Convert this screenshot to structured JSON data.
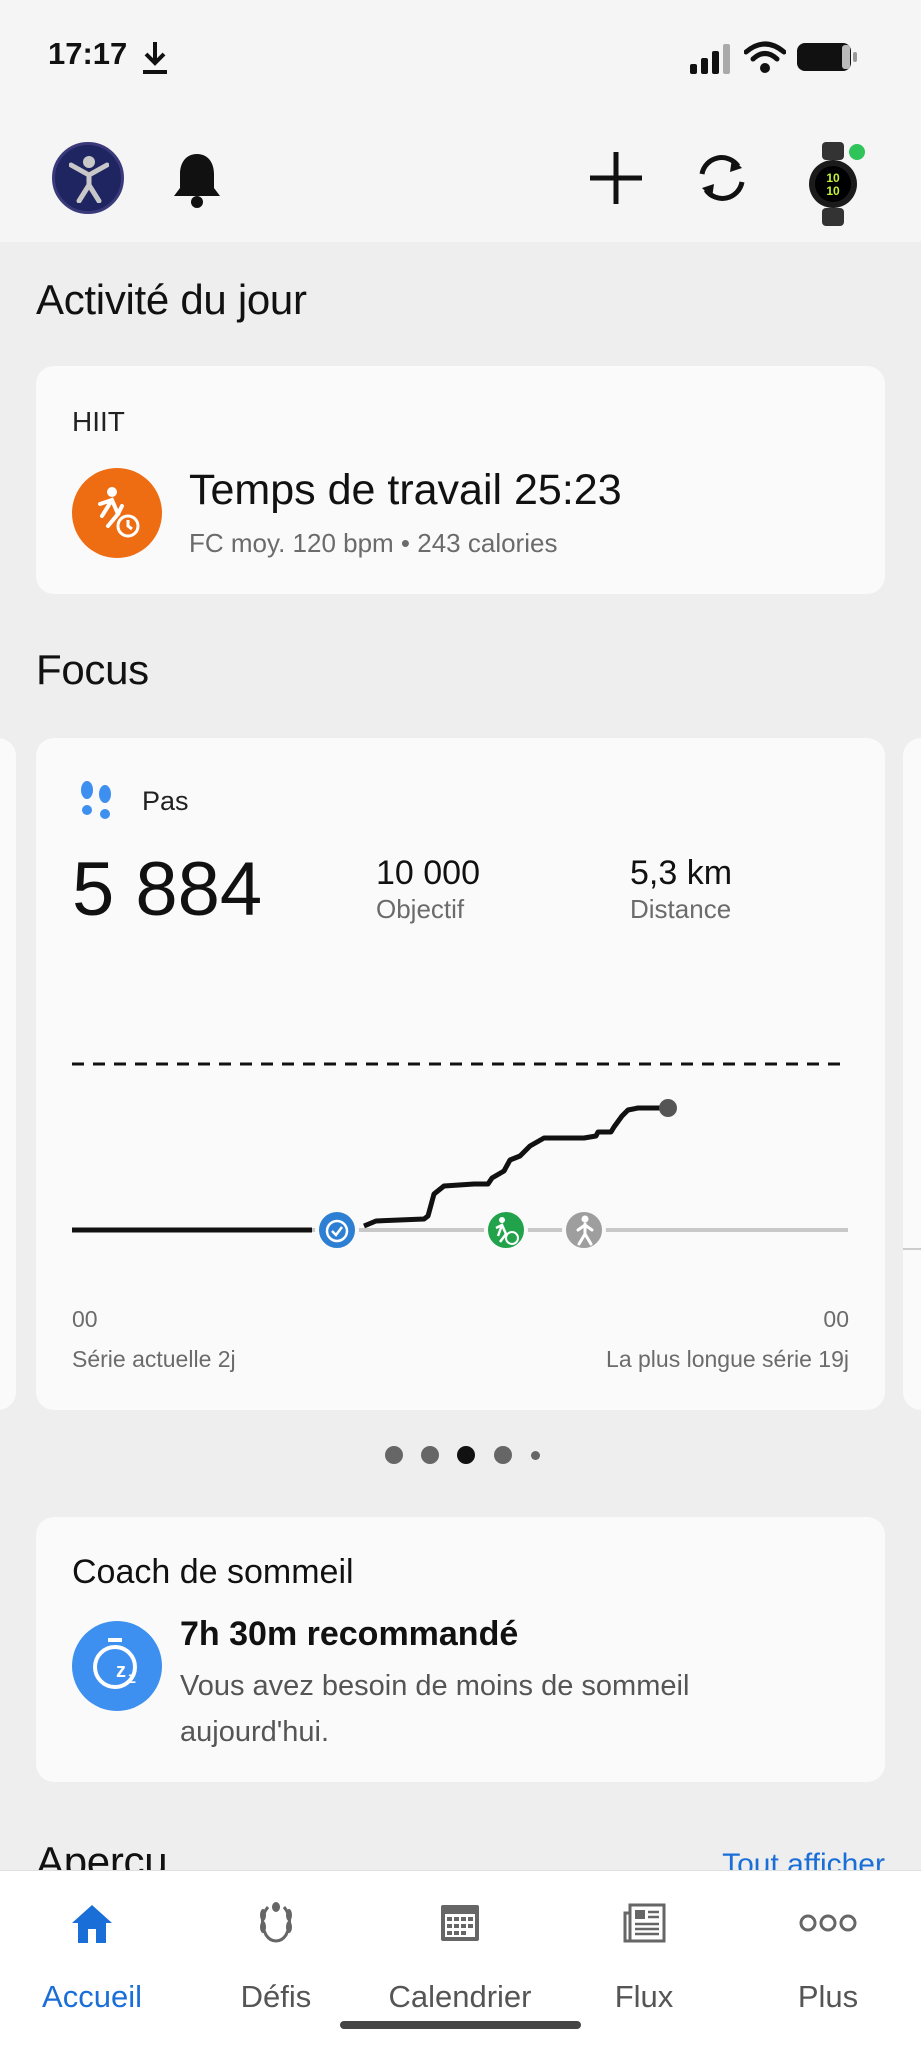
{
  "status": {
    "time": "17:17"
  },
  "today": {
    "section_title": "Activité du jour",
    "activity_type": "HIIT",
    "headline": "Temps de travail 25:23",
    "details": "FC moy. 120 bpm • 243 calories"
  },
  "focus": {
    "section_title": "Focus",
    "card": {
      "label": "Pas",
      "steps": "5 884",
      "goal_value": "10 000",
      "goal_label": "Objectif",
      "distance_value": "5,3 km",
      "distance_label": "Distance",
      "axis_start": "00",
      "axis_end": "00",
      "current_streak": "Série actuelle 2j",
      "longest_streak": "La plus longue série 19j"
    },
    "pager": {
      "count": 5,
      "active_index": 2
    }
  },
  "sleep": {
    "title": "Coach de sommeil",
    "recommendation": "7h 30m recommandé",
    "message": "Vous avez besoin de moins de sommeil aujourd'hui."
  },
  "overview": {
    "title": "Aperçu",
    "see_all": "Tout afficher"
  },
  "nav": {
    "items": [
      {
        "label": "Accueil",
        "icon": "home-icon",
        "active": true
      },
      {
        "label": "Défis",
        "icon": "laurel-icon",
        "active": false
      },
      {
        "label": "Calendrier",
        "icon": "calendar-icon",
        "active": false
      },
      {
        "label": "Flux",
        "icon": "news-feed-icon",
        "active": false
      },
      {
        "label": "Plus",
        "icon": "more-icon",
        "active": false
      }
    ]
  },
  "colors": {
    "accent": "#1a6ed8",
    "activity_orange": "#ee6c12",
    "sleep_blue": "#3d8ff0",
    "timer_blue": "#2d7fd3",
    "run_green": "#22a24a"
  }
}
